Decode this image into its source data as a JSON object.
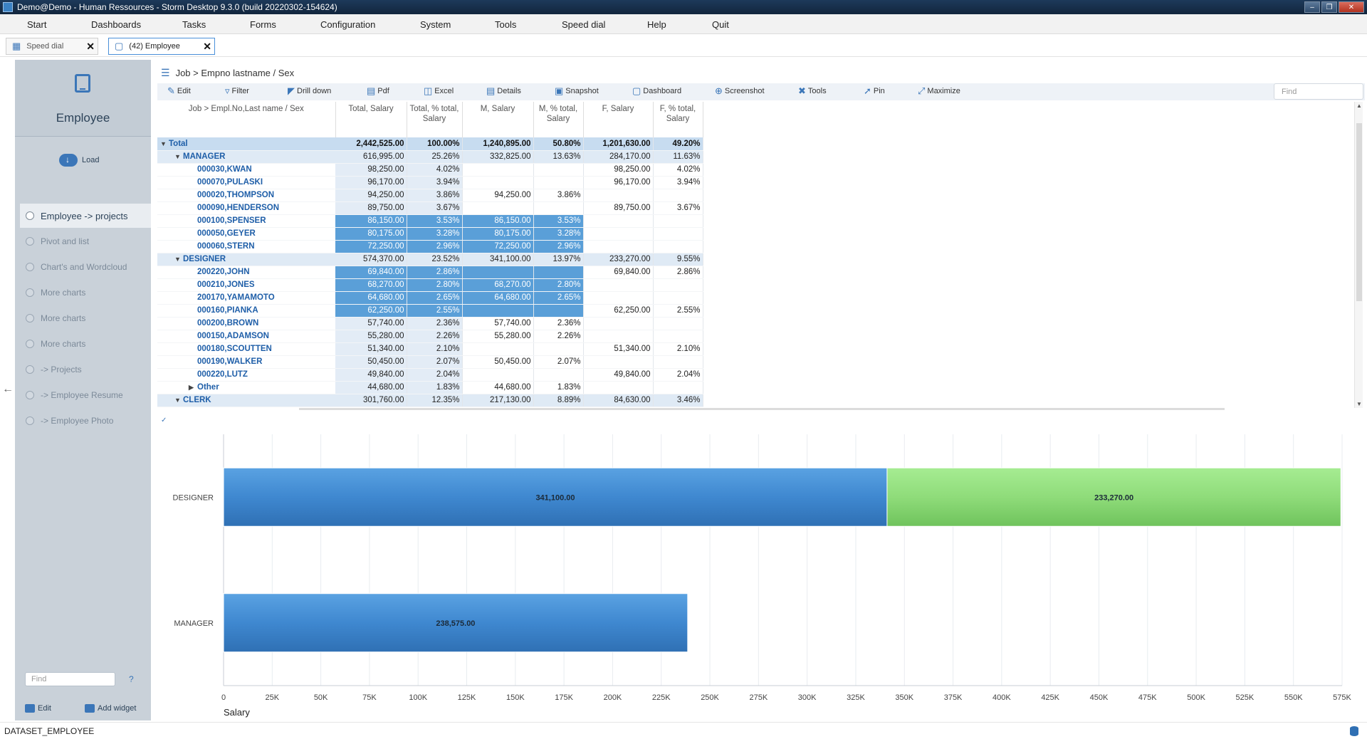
{
  "window": {
    "title": "Demo@Demo - Human Ressources - Storm Desktop 9.3.0 (build 20220302-154624)"
  },
  "menu": [
    "Start",
    "Dashboards",
    "Tasks",
    "Forms",
    "Configuration",
    "System",
    "Tools",
    "Speed dial",
    "Help",
    "Quit"
  ],
  "tabs": [
    {
      "label": "Speed dial",
      "icon": "grid-icon",
      "active": false
    },
    {
      "label": "(42) Employee",
      "icon": "tablet-icon",
      "active": true
    }
  ],
  "sidebar": {
    "title": "Employee",
    "load_label": "Load",
    "items": [
      {
        "label": "Employee -> projects",
        "active": true
      },
      {
        "label": "Pivot and list",
        "active": false
      },
      {
        "label": "Chart's and Wordcloud",
        "active": false
      },
      {
        "label": "More charts",
        "active": false
      },
      {
        "label": "More charts",
        "active": false
      },
      {
        "label": "More charts",
        "active": false
      },
      {
        "label": "-> Projects",
        "active": false
      },
      {
        "label": "-> Employee Resume",
        "active": false
      },
      {
        "label": "-> Employee Photo",
        "active": false
      }
    ],
    "find_placeholder": "Find",
    "help": "?",
    "edit_label": "Edit",
    "add_widget_label": "Add widget"
  },
  "breadcrumb": "Job > Empno lastname / Sex",
  "toolbar": {
    "buttons": [
      {
        "label": "Edit",
        "icon": "edit-icon"
      },
      {
        "label": "Filter",
        "icon": "filter-icon"
      },
      {
        "label": "Drill down",
        "icon": "drill-down-icon"
      },
      {
        "label": "Pdf",
        "icon": "pdf-icon"
      },
      {
        "label": "Excel",
        "icon": "excel-icon"
      },
      {
        "label": "Details",
        "icon": "details-icon"
      },
      {
        "label": "Snapshot",
        "icon": "snapshot-icon"
      },
      {
        "label": "Dashboard",
        "icon": "dashboard-icon"
      },
      {
        "label": "Screenshot",
        "icon": "screenshot-icon"
      },
      {
        "label": "Tools",
        "icon": "tools-icon"
      },
      {
        "label": "Pin",
        "icon": "pin-icon"
      },
      {
        "label": "Maximize",
        "icon": "maximize-icon"
      }
    ],
    "find_placeholder": "Find"
  },
  "grid": {
    "columns": [
      "Job > Empl.No,Last name / Sex",
      "Total, Salary",
      "Total, % total, Salary",
      "M, Salary",
      "M, % total, Salary",
      "F, Salary",
      "F, % total, Salary"
    ],
    "rows": [
      {
        "level": 0,
        "kind": "total",
        "toggle": "down",
        "label": "Total",
        "cells": [
          "2,442,525.00",
          "100.00%",
          "1,240,895.00",
          "50.80%",
          "1,201,630.00",
          "49.20%"
        ]
      },
      {
        "level": 1,
        "kind": "group",
        "toggle": "down",
        "label": "MANAGER",
        "cells": [
          "616,995.00",
          "25.26%",
          "332,825.00",
          "13.63%",
          "284,170.00",
          "11.63%"
        ]
      },
      {
        "level": 2,
        "kind": "leaf",
        "label": "000030,KWAN",
        "cells": [
          "98,250.00",
          "4.02%",
          "",
          "",
          "98,250.00",
          "4.02%"
        ]
      },
      {
        "level": 2,
        "kind": "leaf",
        "label": "000070,PULASKI",
        "cells": [
          "96,170.00",
          "3.94%",
          "",
          "",
          "96,170.00",
          "3.94%"
        ]
      },
      {
        "level": 2,
        "kind": "leaf",
        "label": "000020,THOMPSON",
        "cells": [
          "94,250.00",
          "3.86%",
          "94,250.00",
          "3.86%",
          "",
          ""
        ]
      },
      {
        "level": 2,
        "kind": "leaf",
        "label": "000090,HENDERSON",
        "cells": [
          "89,750.00",
          "3.67%",
          "",
          "",
          "89,750.00",
          "3.67%"
        ]
      },
      {
        "level": 2,
        "kind": "sel",
        "label": "000100,SPENSER",
        "cells": [
          "86,150.00",
          "3.53%",
          "86,150.00",
          "3.53%",
          "",
          ""
        ]
      },
      {
        "level": 2,
        "kind": "sel",
        "label": "000050,GEYER",
        "cells": [
          "80,175.00",
          "3.28%",
          "80,175.00",
          "3.28%",
          "",
          ""
        ]
      },
      {
        "level": 2,
        "kind": "sel",
        "label": "000060,STERN",
        "cells": [
          "72,250.00",
          "2.96%",
          "72,250.00",
          "2.96%",
          "",
          ""
        ]
      },
      {
        "level": 1,
        "kind": "group",
        "toggle": "down",
        "label": "DESIGNER",
        "cells": [
          "574,370.00",
          "23.52%",
          "341,100.00",
          "13.97%",
          "233,270.00",
          "9.55%"
        ]
      },
      {
        "level": 2,
        "kind": "sel",
        "label": "200220,JOHN",
        "cells": [
          "69,840.00",
          "2.86%",
          "",
          "",
          "69,840.00",
          "2.86%"
        ]
      },
      {
        "level": 2,
        "kind": "sel",
        "label": "000210,JONES",
        "cells": [
          "68,270.00",
          "2.80%",
          "68,270.00",
          "2.80%",
          "",
          ""
        ]
      },
      {
        "level": 2,
        "kind": "sel",
        "label": "200170,YAMAMOTO",
        "cells": [
          "64,680.00",
          "2.65%",
          "64,680.00",
          "2.65%",
          "",
          ""
        ]
      },
      {
        "level": 2,
        "kind": "sel",
        "label": "000160,PIANKA",
        "cells": [
          "62,250.00",
          "2.55%",
          "",
          "",
          "62,250.00",
          "2.55%"
        ]
      },
      {
        "level": 2,
        "kind": "leaf",
        "label": "000200,BROWN",
        "cells": [
          "57,740.00",
          "2.36%",
          "57,740.00",
          "2.36%",
          "",
          ""
        ]
      },
      {
        "level": 2,
        "kind": "leaf",
        "label": "000150,ADAMSON",
        "cells": [
          "55,280.00",
          "2.26%",
          "55,280.00",
          "2.26%",
          "",
          ""
        ]
      },
      {
        "level": 2,
        "kind": "leaf",
        "label": "000180,SCOUTTEN",
        "cells": [
          "51,340.00",
          "2.10%",
          "",
          "",
          "51,340.00",
          "2.10%"
        ]
      },
      {
        "level": 2,
        "kind": "leaf",
        "label": "000190,WALKER",
        "cells": [
          "50,450.00",
          "2.07%",
          "50,450.00",
          "2.07%",
          "",
          ""
        ]
      },
      {
        "level": 2,
        "kind": "leaf",
        "label": "000220,LUTZ",
        "cells": [
          "49,840.00",
          "2.04%",
          "",
          "",
          "49,840.00",
          "2.04%"
        ]
      },
      {
        "level": 2,
        "kind": "other",
        "toggle": "right",
        "label": "Other",
        "cells": [
          "44,680.00",
          "1.83%",
          "44,680.00",
          "1.83%",
          "",
          ""
        ]
      },
      {
        "level": 1,
        "kind": "group",
        "toggle": "down",
        "label": "CLERK",
        "cells": [
          "301,760.00",
          "12.35%",
          "217,130.00",
          "8.89%",
          "84,630.00",
          "3.46%"
        ]
      }
    ]
  },
  "chart_data": {
    "type": "bar",
    "orientation": "horizontal",
    "stacked": true,
    "categories": [
      "DESIGNER",
      "MANAGER"
    ],
    "series": [
      {
        "values": [
          341100,
          238575
        ],
        "color": "#3f88d0"
      },
      {
        "values": [
          233270,
          0
        ],
        "color": "#8fdc7a"
      }
    ],
    "data_labels": [
      [
        "341,100.00",
        "238,575.00"
      ],
      [
        "233,270.00",
        ""
      ]
    ],
    "xlabel": "Salary",
    "xlim": [
      0,
      575000
    ],
    "xticks": [
      0,
      25000,
      50000,
      75000,
      100000,
      125000,
      150000,
      175000,
      200000,
      225000,
      250000,
      275000,
      300000,
      325000,
      350000,
      375000,
      400000,
      425000,
      450000,
      475000,
      500000,
      525000,
      550000,
      575000
    ],
    "xtick_labels": [
      "0",
      "25K",
      "50K",
      "75K",
      "100K",
      "125K",
      "150K",
      "175K",
      "200K",
      "225K",
      "250K",
      "275K",
      "300K",
      "325K",
      "350K",
      "375K",
      "400K",
      "425K",
      "450K",
      "475K",
      "500K",
      "525K",
      "550K",
      "575K"
    ],
    "grid": true
  },
  "statusbar": {
    "dataset": "DATASET_EMPLOYEE"
  }
}
